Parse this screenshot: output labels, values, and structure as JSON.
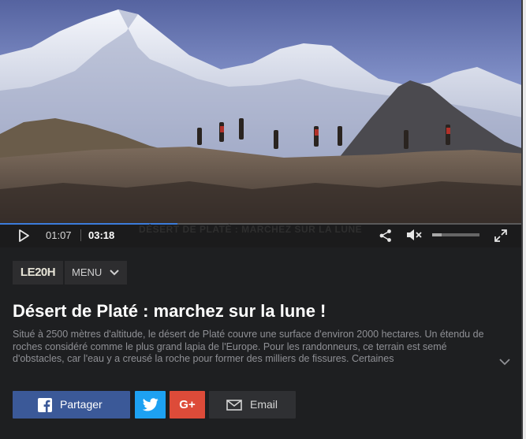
{
  "video": {
    "thumbnail_icon": "mountain-hikers-scene",
    "progress_fraction": 0.337,
    "ghost_caption": "DÉSERT DE PLATÉ : MARCHEZ SUR LA LUNE",
    "current_time": "01:07",
    "total_time": "03:18",
    "volume_fraction": 0.2,
    "muted": true,
    "icons": {
      "play": "play-icon",
      "share": "share-icon",
      "mute": "mute-icon",
      "fullscreen": "fullscreen-icon"
    }
  },
  "header": {
    "logo_text": "LE20H",
    "menu_label": "MENU"
  },
  "article": {
    "title": "Désert de Platé : marchez sur la lune !",
    "description": "Situé à 2500 mètres d'altitude, le désert de Platé couvre une surface d'environ 2000 hectares. Un étendu de roches considéré comme le plus grand lapia de l'Europe. Pour les randonneurs, ce terrain est semé d'obstacles, car l'eau y a creusé la roche pour former des milliers de fissures. Certaines"
  },
  "share": {
    "facebook_label": "Partager",
    "googleplus_label": "G+",
    "email_label": "Email"
  },
  "colors": {
    "background": "#1e1f21",
    "progress": "#3c7cdb",
    "facebook": "#3b5998",
    "twitter": "#1da1f2",
    "googleplus": "#dd4b39",
    "email": "#2f3033"
  }
}
